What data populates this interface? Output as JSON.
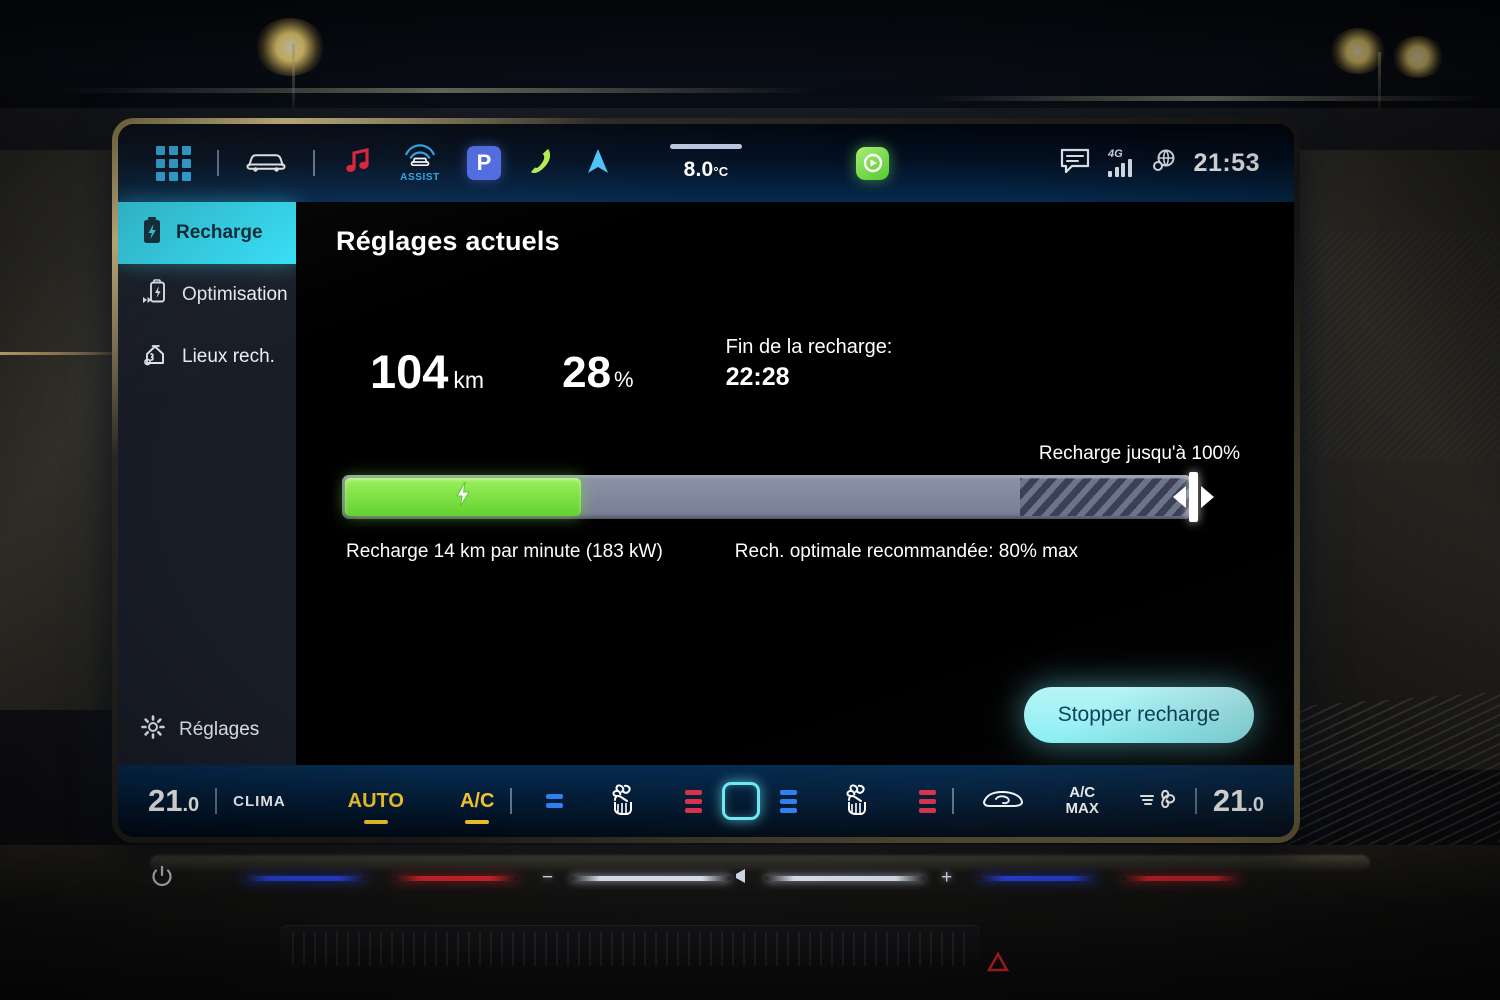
{
  "status_bar": {
    "icons": [
      "apps-grid-icon",
      "vehicle-icon",
      "music-note-icon",
      "assist-icon",
      "park-assist-icon",
      "phone-icon",
      "navigation-arrow-icon"
    ],
    "assist_label": "ASSIST",
    "park_label": "P",
    "outside_temperature": "8.0",
    "temperature_unit": "°C",
    "carplay_icon": "carplay-app-icon",
    "message_icon": "message-bubble-icon",
    "network_generation": "4G",
    "signal_icon": "signal-bars-icon",
    "globe_icon": "globe-connectivity-icon",
    "clock": "21:53"
  },
  "sidebar": {
    "items": [
      {
        "label": "Recharge",
        "icon": "battery-bolt-icon",
        "active": true
      },
      {
        "label": "Optimisation",
        "icon": "battery-optimise-icon",
        "active": false
      },
      {
        "label": "Lieux rech.",
        "icon": "charging-location-icon",
        "active": false
      }
    ],
    "bottom": {
      "label": "Réglages",
      "icon": "gear-icon"
    }
  },
  "main": {
    "title": "Réglages actuels",
    "range_value": "104",
    "range_unit": "km",
    "battery_value": "28",
    "battery_unit": "%",
    "end_label": "Fin de la recharge:",
    "end_time": "22:28",
    "limit_label": "Recharge jusqu'à 100%",
    "bolt_icon": "lightning-bolt-icon",
    "slider_handle_icon": "slider-handle-arrows-icon",
    "rate_text": "Recharge 14 km par minute (183 kW)",
    "recommendation_text": "Rech. optimale recommandée: 80% max",
    "stop_button_label": "Stopper recharge"
  },
  "charge": {
    "current_percent": 28,
    "target_percent": 100,
    "recommended_max_percent": 80
  },
  "climate": {
    "left_temperature": "21",
    "left_temperature_decimal": ".0",
    "clima_label": "CLIMA",
    "auto_label": "AUTO",
    "ac_label": "A/C",
    "acmax_label_top": "A/C",
    "acmax_label_bottom": "MAX",
    "right_temperature": "21",
    "right_temperature_decimal": ".0",
    "icons": [
      "fan-hand-left-icon",
      "center-vent-icon",
      "fan-hand-right-icon",
      "recirculation-icon",
      "blower-icon"
    ]
  },
  "hardware_bar": {
    "power_icon": "power-button-icon",
    "minus_label": "−",
    "plus_label": "+",
    "speaker_icon": "speaker-volume-icon"
  },
  "colors": {
    "accent_cyan": "#35dcf4",
    "charge_green": "#7ceb46",
    "warm_amber": "#f2c32d",
    "cold_blue": "#2f7ff0",
    "hot_red": "#d8324a"
  }
}
